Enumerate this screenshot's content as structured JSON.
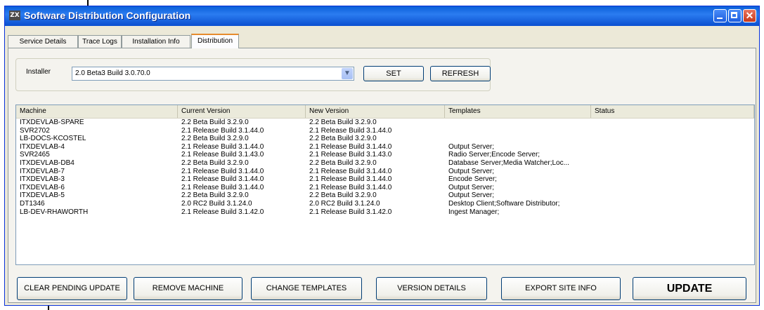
{
  "window": {
    "title": "Software Distribution Configuration",
    "icon_label": "ZX"
  },
  "tabs": [
    "Service Details",
    "Trace Logs",
    "Installation Info",
    "Distribution"
  ],
  "active_tab": "Distribution",
  "installer": {
    "label": "Installer",
    "value": "2.0 Beta3 Build 3.0.70.0",
    "set_label": "SET",
    "refresh_label": "REFRESH"
  },
  "table": {
    "columns": [
      "Machine",
      "Current Version",
      "New Version",
      "Templates",
      "Status"
    ],
    "rows": [
      [
        "ITXDEVLAB-SPARE",
        "2.2 Beta Build 3.2.9.0",
        "2.2 Beta Build 3.2.9.0",
        "",
        ""
      ],
      [
        "SVR2702",
        "2.1 Release Build 3.1.44.0",
        "2.1 Release Build 3.1.44.0",
        "",
        ""
      ],
      [
        "LB-DOCS-KCOSTEL",
        "2.2 Beta Build 3.2.9.0",
        "2.2 Beta Build 3.2.9.0",
        "",
        ""
      ],
      [
        "ITXDEVLAB-4",
        "2.1 Release Build 3.1.44.0",
        "2.1 Release Build 3.1.44.0",
        "Output Server;",
        ""
      ],
      [
        "SVR2465",
        "2.1 Release Build 3.1.43.0",
        "2.1 Release Build 3.1.43.0",
        "Radio Server;Encode Server;",
        ""
      ],
      [
        "ITXDEVLAB-DB4",
        "2.2 Beta Build 3.2.9.0",
        "2.2 Beta Build 3.2.9.0",
        "Database Server;Media Watcher;Loc...",
        ""
      ],
      [
        "ITXDEVLAB-7",
        "2.1 Release Build 3.1.44.0",
        "2.1 Release Build 3.1.44.0",
        "Output Server;",
        ""
      ],
      [
        "ITXDEVLAB-3",
        "2.1 Release Build 3.1.44.0",
        "2.1 Release Build 3.1.44.0",
        "Encode Server;",
        ""
      ],
      [
        "ITXDEVLAB-6",
        "2.1 Release Build 3.1.44.0",
        "2.1 Release Build 3.1.44.0",
        "Output Server;",
        ""
      ],
      [
        "ITXDEVLAB-5",
        "2.2 Beta Build 3.2.9.0",
        "2.2 Beta Build 3.2.9.0",
        "Output Server;",
        ""
      ],
      [
        "DT1346",
        "2.0 RC2 Build 3.1.24.0",
        "2.0 RC2 Build 3.1.24.0",
        "Desktop Client;Software Distributor;",
        ""
      ],
      [
        "LB-DEV-RHAWORTH",
        "2.1 Release Build 3.1.42.0",
        "2.1 Release Build 3.1.42.0",
        "Ingest Manager;",
        ""
      ]
    ]
  },
  "buttons": {
    "clear_pending": "CLEAR PENDING UPDATE",
    "remove_machine": "REMOVE MACHINE",
    "change_templates": "CHANGE TEMPLATES",
    "version_details": "VERSION DETAILS",
    "export_site_info": "EXPORT SITE INFO",
    "update": "UPDATE"
  },
  "colors": {
    "titlebar": "#0a5fd8",
    "window_bg": "#ece9d8",
    "active_tab_accent": "#e68b2c"
  }
}
